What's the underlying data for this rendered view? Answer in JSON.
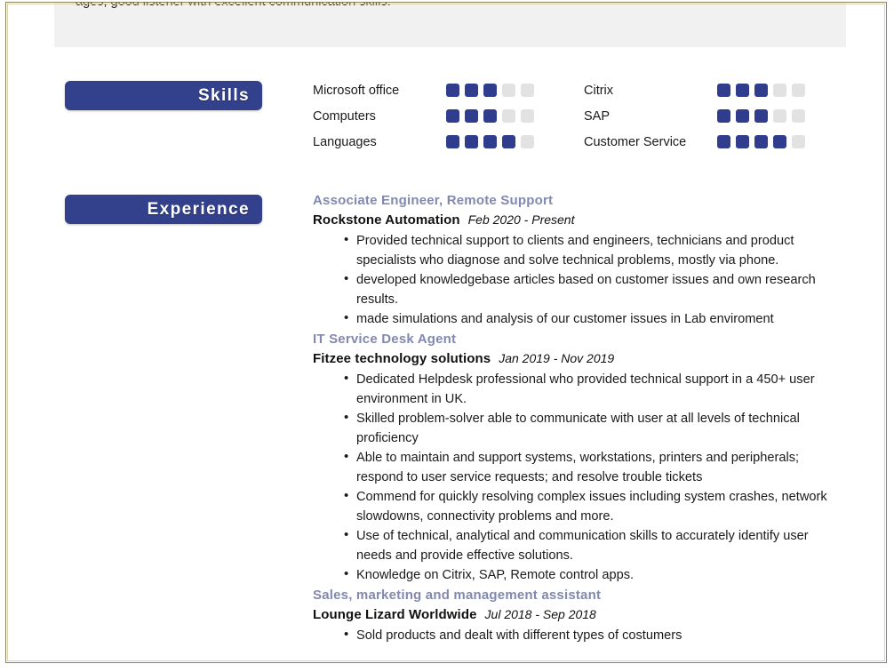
{
  "document": {
    "summary_fragment": "ages, good listener with excellent communication skills.",
    "accent_color": "#33408c",
    "title_color": "#8289b0",
    "frame_color": "#8a8660",
    "panel_color": "#f1f1f1",
    "dot_filled_color": "#2f3d8c",
    "dot_empty_color": "#e2e2e2"
  },
  "sections": {
    "skills": {
      "badge_label": "Skills",
      "max_rating": 5,
      "columns": [
        {
          "items": [
            {
              "name": "Microsoft office",
              "rating": 3
            },
            {
              "name": "Computers",
              "rating": 3
            },
            {
              "name": "Languages",
              "rating": 4
            }
          ]
        },
        {
          "items": [
            {
              "name": "Citrix",
              "rating": 3
            },
            {
              "name": "SAP",
              "rating": 3
            },
            {
              "name": "Customer Service",
              "rating": 4
            }
          ]
        }
      ]
    },
    "experience": {
      "badge_label": "Experience",
      "jobs": [
        {
          "title": "Associate Engineer, Remote Support",
          "company": "Rockstone Automation",
          "dates": "Feb 2020 - Present",
          "bullets": [
            "Provided technical support to clients and engineers, technicians and product specialists who diagnose and solve technical problems, mostly via phone.",
            "developed knowledgebase articles based on customer issues and own research results.",
            "made simulations and analysis of our customer issues in Lab enviroment"
          ]
        },
        {
          "title": "IT Service Desk Agent",
          "company": "Fitzee technology solutions",
          "dates": "Jan 2019 - Nov 2019",
          "bullets": [
            "Dedicated Helpdesk professional who provided technical support in a 450+ user environment in UK.",
            "Skilled problem-solver able to communicate with user at all levels of technical proficiency",
            "Able to maintain and support systems, workstations, printers and peripherals; respond to user service requests; and resolve trouble tickets",
            "Commend for quickly resolving complex issues including system crashes, network slowdowns, connectivity problems and more.",
            "Use of technical, analytical and communication skills to accurately identify user needs and provide effective solutions.",
            "Knowledge on Citrix, SAP, Remote control apps."
          ]
        },
        {
          "title": "Sales, marketing and management assistant",
          "company": "Lounge Lizard Worldwide",
          "dates": "Jul 2018 - Sep 2018",
          "bullets": [
            "Sold products and dealt with different types of costumers"
          ]
        }
      ]
    }
  }
}
